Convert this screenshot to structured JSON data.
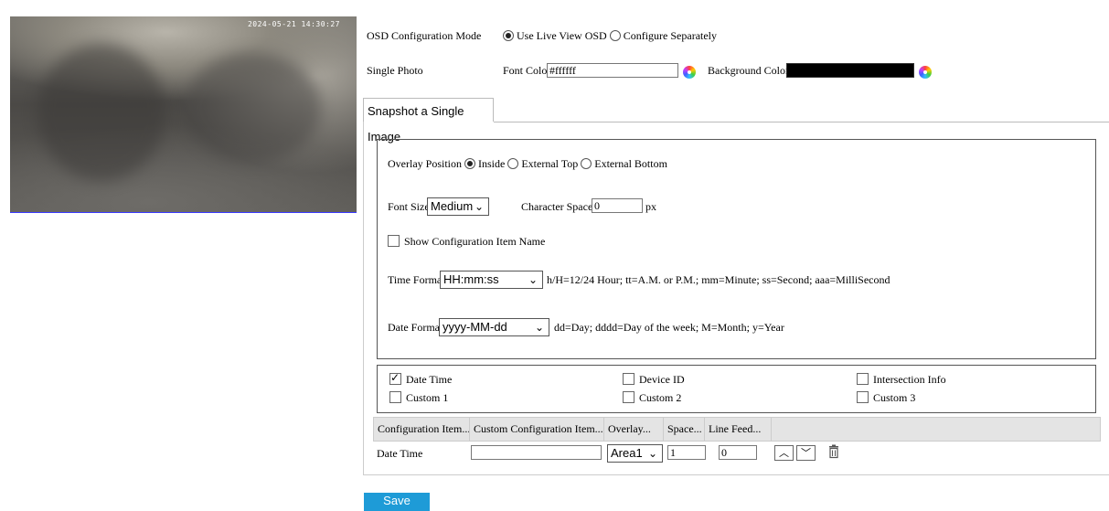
{
  "preview": {
    "osd_text": "2024-05-21 14:30:27"
  },
  "osd_mode": {
    "label": "OSD Configuration Mode",
    "options": [
      "Use Live View OSD",
      "Configure Separately"
    ],
    "selected": "Use Live View OSD"
  },
  "single_photo": {
    "label": "Single Photo",
    "font_color_label": "Font Color",
    "font_color_value": "#ffffff",
    "background_color_label": "Background Color",
    "background_color_value": "#000000"
  },
  "tab": {
    "label": "Snapshot a Single Image"
  },
  "overlay_position": {
    "label": "Overlay Position",
    "options": [
      "Inside",
      "External Top",
      "External Bottom"
    ],
    "selected": "Inside"
  },
  "font_size": {
    "label": "Font Size",
    "value": "Medium"
  },
  "character_space": {
    "label": "Character Space",
    "value": "0",
    "unit": "px"
  },
  "show_config_item_name": {
    "label": "Show Configuration Item Name",
    "checked": false
  },
  "time_format": {
    "label": "Time Format",
    "value": "HH:mm:ss",
    "hint": "h/H=12/24 Hour; tt=A.M. or P.M.; mm=Minute; ss=Second; aaa=MilliSecond"
  },
  "date_format": {
    "label": "Date Format",
    "value": "yyyy-MM-dd",
    "hint": "dd=Day; dddd=Day of the week; M=Month; y=Year"
  },
  "items": [
    {
      "label": "Date Time",
      "checked": true
    },
    {
      "label": "Device ID",
      "checked": false
    },
    {
      "label": "Intersection Info",
      "checked": false
    },
    {
      "label": "Custom 1",
      "checked": false
    },
    {
      "label": "Custom 2",
      "checked": false
    },
    {
      "label": "Custom 3",
      "checked": false
    }
  ],
  "table": {
    "headers": [
      "Configuration Item...",
      "Custom Configuration Item...",
      "Overlay...",
      "Space...",
      "Line Feed..."
    ],
    "rows": [
      {
        "item": "Date Time",
        "custom": "",
        "overlay": "Area1",
        "space": "1",
        "line_feed": "0"
      }
    ]
  },
  "save_label": "Save"
}
